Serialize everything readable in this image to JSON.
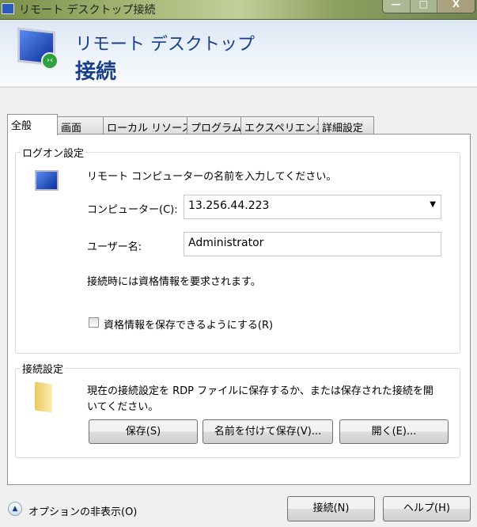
{
  "window": {
    "title": "リモート デスクトップ接続",
    "min": "—",
    "max": "□",
    "close": "X"
  },
  "header": {
    "line1": "リモート デスクトップ",
    "line2": "接続"
  },
  "tabs": [
    "全般",
    "画面",
    "ローカル リソース",
    "プログラム",
    "エクスペリエンス",
    "詳細設定"
  ],
  "logon": {
    "legend": "ログオン設定",
    "instruction": "リモート コンピューターの名前を入力してください。",
    "computer_label": "コンピューター(C):",
    "computer_value": "13.256.44.223",
    "user_label": "ユーザー名:",
    "user_value": "Administrator",
    "credentials_note": "接続時には資格情報を要求されます。",
    "save_credentials_label": "資格情報を保存できるようにする(R)",
    "save_credentials_checked": false
  },
  "connection": {
    "legend": "接続設定",
    "description": "現在の接続設定を RDP ファイルに保存するか、または保存された接続を開いてください。",
    "save": "保存(S)",
    "save_as": "名前を付けて保存(V)...",
    "open": "開く(E)..."
  },
  "footer": {
    "hide_options": "オプションの非表示(O)",
    "connect": "接続(N)",
    "help": "ヘルプ(H)"
  }
}
